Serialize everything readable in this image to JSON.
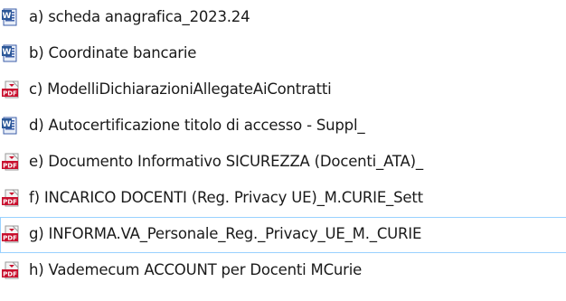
{
  "files": [
    {
      "icon": "word-document-icon",
      "name": "a) scheda anagrafica_2023.24",
      "selected": false
    },
    {
      "icon": "word-document-icon",
      "name": "b) Coordinate bancarie",
      "selected": false
    },
    {
      "icon": "pdf-document-icon",
      "name": "c) ModelliDichiarazioniAllegateAiContratti",
      "selected": false
    },
    {
      "icon": "word-document-icon",
      "name": "d) Autocertificazione titolo di accesso - Suppl_",
      "selected": false
    },
    {
      "icon": "pdf-document-icon",
      "name": "e) Documento Informativo SICUREZZA (Docenti_ATA)_",
      "selected": false
    },
    {
      "icon": "pdf-document-icon",
      "name": "f) INCARICO DOCENTI (Reg. Privacy UE)_M.CURIE_Sett",
      "selected": false
    },
    {
      "icon": "pdf-document-icon",
      "name": "g) INFORMA.VA_Personale_Reg._Privacy_UE_M._CURIE",
      "selected": true
    },
    {
      "icon": "pdf-document-icon",
      "name": "h) Vademecum ACCOUNT per Docenti MCurie",
      "selected": false
    }
  ],
  "colors": {
    "selection_border": "#99d1ff",
    "pdf_red": "#c8102e",
    "word_blue": "#2b5797"
  }
}
